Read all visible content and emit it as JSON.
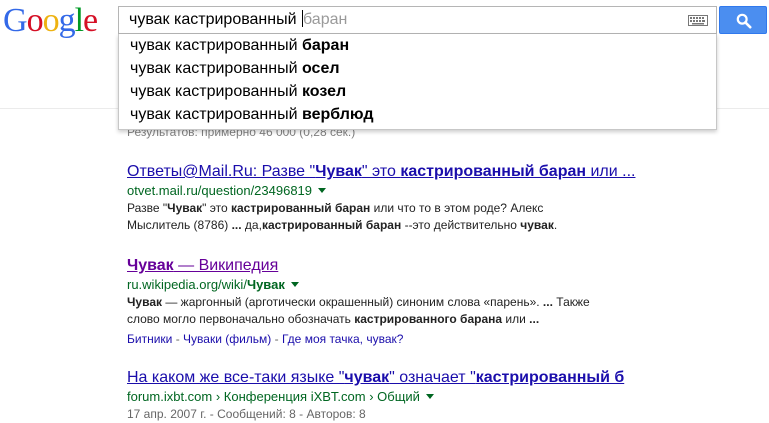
{
  "logo": {
    "letters": [
      {
        "ch": "G",
        "color": "#3369e8"
      },
      {
        "ch": "o",
        "color": "#d50f25"
      },
      {
        "ch": "o",
        "color": "#eeb211"
      },
      {
        "ch": "g",
        "color": "#3369e8"
      },
      {
        "ch": "l",
        "color": "#009925"
      },
      {
        "ch": "e",
        "color": "#d50f25"
      }
    ]
  },
  "search": {
    "query": "чувак кастрированный",
    "hint": "баран"
  },
  "suggestions": [
    {
      "prefix": "чувак кастрированный ",
      "bold": "баран"
    },
    {
      "prefix": "чувак кастрированный ",
      "bold": "осел"
    },
    {
      "prefix": "чувак кастрированный ",
      "bold": "козел"
    },
    {
      "prefix": "чувак кастрированный ",
      "bold": "верблюд"
    }
  ],
  "stats": "Результатов: примерно 46 000 (0,28 сек.)",
  "results": [
    {
      "title": [
        "Ответы@Mail.Ru: Разве \"",
        "Чувак",
        "\" это ",
        "кастрированный баран",
        " или ..."
      ],
      "url": [
        "otvet.mail.ru/question/23496819"
      ],
      "snippet_1": [
        "Разве \"",
        "Чувак",
        "\" это ",
        "кастрированный баран",
        " или что то в этом роде? Алекс"
      ],
      "snippet_2": [
        "Мыслитель (8786) ",
        "...",
        " да,",
        "кастрированный баран",
        " --это действительно ",
        "чувак",
        "."
      ]
    },
    {
      "title": [
        "Чувак",
        " — Википедия"
      ],
      "url": [
        "ru.wikipedia.org/wiki/",
        "Чувак"
      ],
      "snippet_1": [
        "Чувак",
        " — жаргонный (арготически окрашенный) синоним слова «парень». ",
        "...",
        " Также"
      ],
      "snippet_2": [
        "слово могло первоначально обозначать ",
        "кастрированного барана",
        " или  ",
        "..."
      ],
      "sitelinks": [
        "Битники",
        "Чуваки (фильм)",
        "Где моя тачка, чувак?"
      ]
    },
    {
      "title": [
        "На каком же все-таки языке \"",
        "чувак",
        "\" означает \"",
        "кастрированный б"
      ],
      "url": [
        "forum.ixbt.com › Конференция iXBT.com › Общий"
      ],
      "meta": "17 апр. 2007 г. - Сообщений: 8 - Авторов: 8"
    }
  ]
}
